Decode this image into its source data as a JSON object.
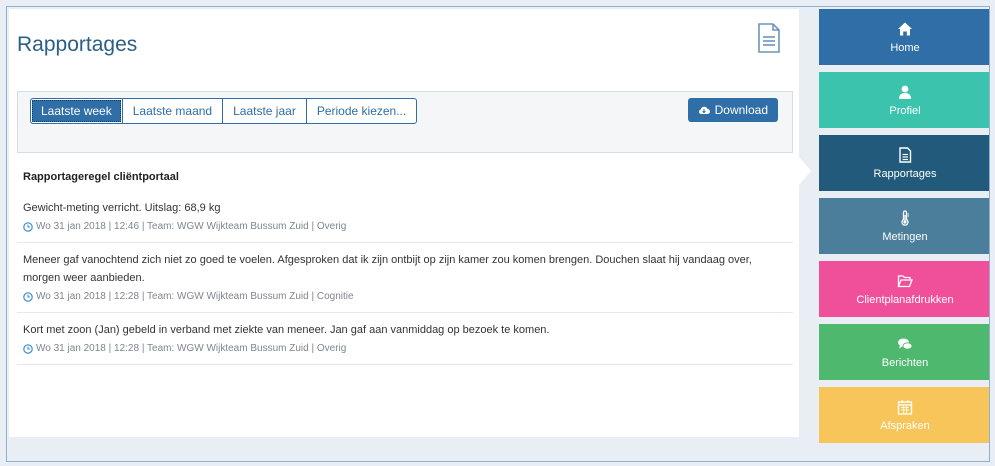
{
  "page": {
    "title": "Rapportages"
  },
  "filters": {
    "buttons": [
      {
        "label": "Laatste week",
        "active": true
      },
      {
        "label": "Laatste maand",
        "active": false
      },
      {
        "label": "Laatste jaar",
        "active": false
      },
      {
        "label": "Periode kiezen...",
        "active": false
      }
    ],
    "download_label": "Download"
  },
  "section": {
    "title": "Rapportageregel cliëntportaal"
  },
  "reports": [
    {
      "text": "Gewicht-meting verricht. Uitslag: 68,9 kg",
      "meta": "Wo 31 jan 2018 | 12:46 | Team: WGW Wijkteam Bussum Zuid | Overig"
    },
    {
      "text": "Meneer gaf vanochtend zich niet zo goed te voelen. Afgesproken dat ik zijn ontbijt op zijn kamer zou komen brengen. Douchen slaat hij vandaag over, morgen weer aanbieden.",
      "meta": "Wo 31 jan 2018 | 12:28 | Team: WGW Wijkteam Bussum Zuid | Cognitie"
    },
    {
      "text": "Kort met zoon (Jan) gebeld in verband met ziekte van meneer. Jan gaf aan vanmiddag op bezoek te komen.",
      "meta": "Wo 31 jan 2018 | 12:28 | Team: WGW Wijkteam Bussum Zuid | Overig"
    }
  ],
  "sidebar": {
    "items": [
      {
        "label": "Home",
        "icon": "home-icon",
        "color": "#2f6ea6"
      },
      {
        "label": "Profiel",
        "icon": "user-icon",
        "color": "#3cc3ad"
      },
      {
        "label": "Rapportages",
        "icon": "document-icon",
        "color": "#215a7a"
      },
      {
        "label": "Metingen",
        "icon": "thermometer-icon",
        "color": "#4a7e9a"
      },
      {
        "label": "Clientplanafdrukken",
        "icon": "folder-open-icon",
        "color": "#f0509a"
      },
      {
        "label": "Berichten",
        "icon": "chat-icon",
        "color": "#4db86e"
      },
      {
        "label": "Afspraken",
        "icon": "calendar-icon",
        "color": "#f7c55a"
      }
    ]
  }
}
